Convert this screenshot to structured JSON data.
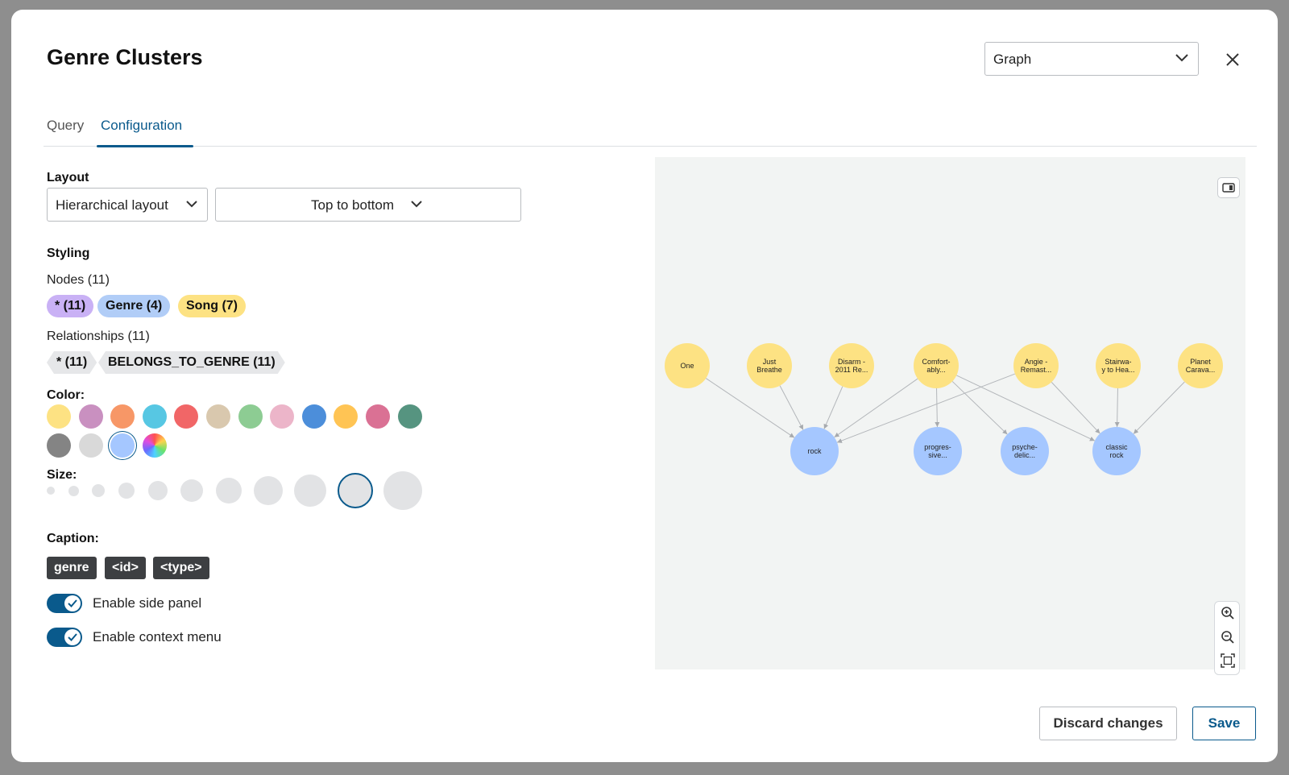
{
  "header": {
    "title": "Genre Clusters"
  },
  "view_select": {
    "value": "Graph"
  },
  "tabs": [
    {
      "label": "Query",
      "active": false
    },
    {
      "label": "Configuration",
      "active": true
    }
  ],
  "layout": {
    "label": "Layout",
    "algorithm": "Hierarchical layout",
    "direction": "Top to bottom"
  },
  "styling": {
    "label": "Styling",
    "nodes_label": "Nodes (11)",
    "node_chips": [
      {
        "label": "* (11)",
        "color": "#c9b1f5"
      },
      {
        "label": "Genre (4)",
        "color": "#b1cdf7"
      },
      {
        "label": "Song (7)",
        "color": "#fde283"
      }
    ],
    "relationships_label": "Relationships (11)",
    "relationship_chips": [
      {
        "label": "* (11)"
      },
      {
        "label": "BELONGS_TO_GENRE (11)"
      }
    ]
  },
  "color": {
    "label": "Color:",
    "swatches": [
      "#fde283",
      "#c990c0",
      "#f79767",
      "#57c7e3",
      "#f16667",
      "#d9c8ae",
      "#8dcc93",
      "#ecb5c9",
      "#4c8eda",
      "#ffc454",
      "#da7194",
      "#569480",
      "#848484",
      "#d9d9d9",
      "#a5c7ff",
      "rainbow"
    ],
    "selected_index": 14
  },
  "size": {
    "label": "Size:",
    "option_count": 12,
    "selected_index": 10
  },
  "caption": {
    "label": "Caption:",
    "chips": [
      "genre",
      "<id>",
      "<type>"
    ]
  },
  "toggles": [
    {
      "label": "Enable side panel",
      "on": true
    },
    {
      "label": "Enable context menu",
      "on": true
    }
  ],
  "graph": {
    "song_color": "#fde283",
    "genre_color": "#a5c7ff",
    "songs": [
      [
        "One"
      ],
      [
        "Just",
        "Breathe"
      ],
      [
        "Disarm -",
        "2011 Re..."
      ],
      [
        "Comfort-",
        "ably..."
      ],
      [
        "Angie -",
        "Remast..."
      ],
      [
        "Stairwa-",
        "y to Hea..."
      ],
      [
        "Planet",
        "Carava..."
      ]
    ],
    "genres": [
      [
        "rock"
      ],
      [
        "progres-",
        "sive..."
      ],
      [
        "psyche-",
        "delic..."
      ],
      [
        "classic",
        "rock"
      ]
    ],
    "edges": [
      [
        0,
        0
      ],
      [
        1,
        0
      ],
      [
        2,
        0
      ],
      [
        3,
        0
      ],
      [
        4,
        0
      ],
      [
        3,
        1
      ],
      [
        3,
        2
      ],
      [
        3,
        3
      ],
      [
        4,
        3
      ],
      [
        5,
        3
      ],
      [
        6,
        3
      ]
    ]
  },
  "footer": {
    "discard_label": "Discard changes",
    "save_label": "Save"
  }
}
